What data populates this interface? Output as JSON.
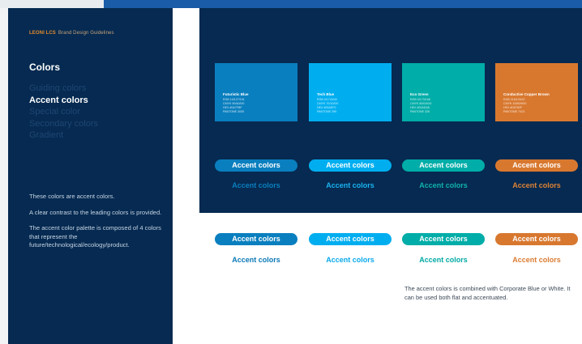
{
  "sidebar": {
    "brand_strong": "LEONI LCS",
    "brand_light": "Brand Design Guidelines",
    "section_title": "Colors",
    "nav": [
      {
        "label": "Guiding colors",
        "active": false
      },
      {
        "label": "Accent colors",
        "active": true
      },
      {
        "label": "Special color",
        "active": false
      },
      {
        "label": "Secondary colors",
        "active": false
      },
      {
        "label": "Gradient",
        "active": false
      }
    ],
    "description": [
      "These colors are accent colors.",
      "A clear contrast to the leading colors is provided.",
      "The accent color palette is composed of 4 colors that represent the future/technological/ecology/product."
    ]
  },
  "swatches": [
    {
      "name": "Futuristic Blue",
      "color": "#0a7fbf",
      "specs": [
        "RGB 10/127/191",
        "CMYK 90/40/0/0",
        "HEX #0A7FBF",
        "PANTONE 3005"
      ]
    },
    {
      "name": "Tech Blue",
      "color": "#00aef0",
      "specs": [
        "RGB 0/174/240",
        "CMYK 70/10/0/0",
        "HEX #00AEF0",
        "PANTONE 299"
      ]
    },
    {
      "name": "Eco Green",
      "color": "#00ada8",
      "specs": [
        "RGB 0/173/168",
        "CMYK 80/0/40/0",
        "HEX #00ADA8",
        "PANTONE 326"
      ]
    },
    {
      "name": "Conductive Copper Brown",
      "color": "#d8782f",
      "specs": [
        "RGB 216/120/47",
        "CMYK 10/60/90/0",
        "HEX #D8782F",
        "PANTONE 7413"
      ]
    }
  ],
  "dark_row": {
    "pill_label": "Accent colors",
    "text_label": "Accent colors",
    "text_colors": [
      "#0a7fbf",
      "#1ab4f2",
      "#10b3ad",
      "#e08234"
    ]
  },
  "light_row": {
    "pill_label": "Accent colors",
    "text_label": "Accent colors",
    "text_colors": [
      "#0a78b6",
      "#0aa9ea",
      "#00a9a3",
      "#db7b33"
    ]
  },
  "note": "The accent colors is combined with Corporate Blue or White. It can be used both flat and accentuated."
}
